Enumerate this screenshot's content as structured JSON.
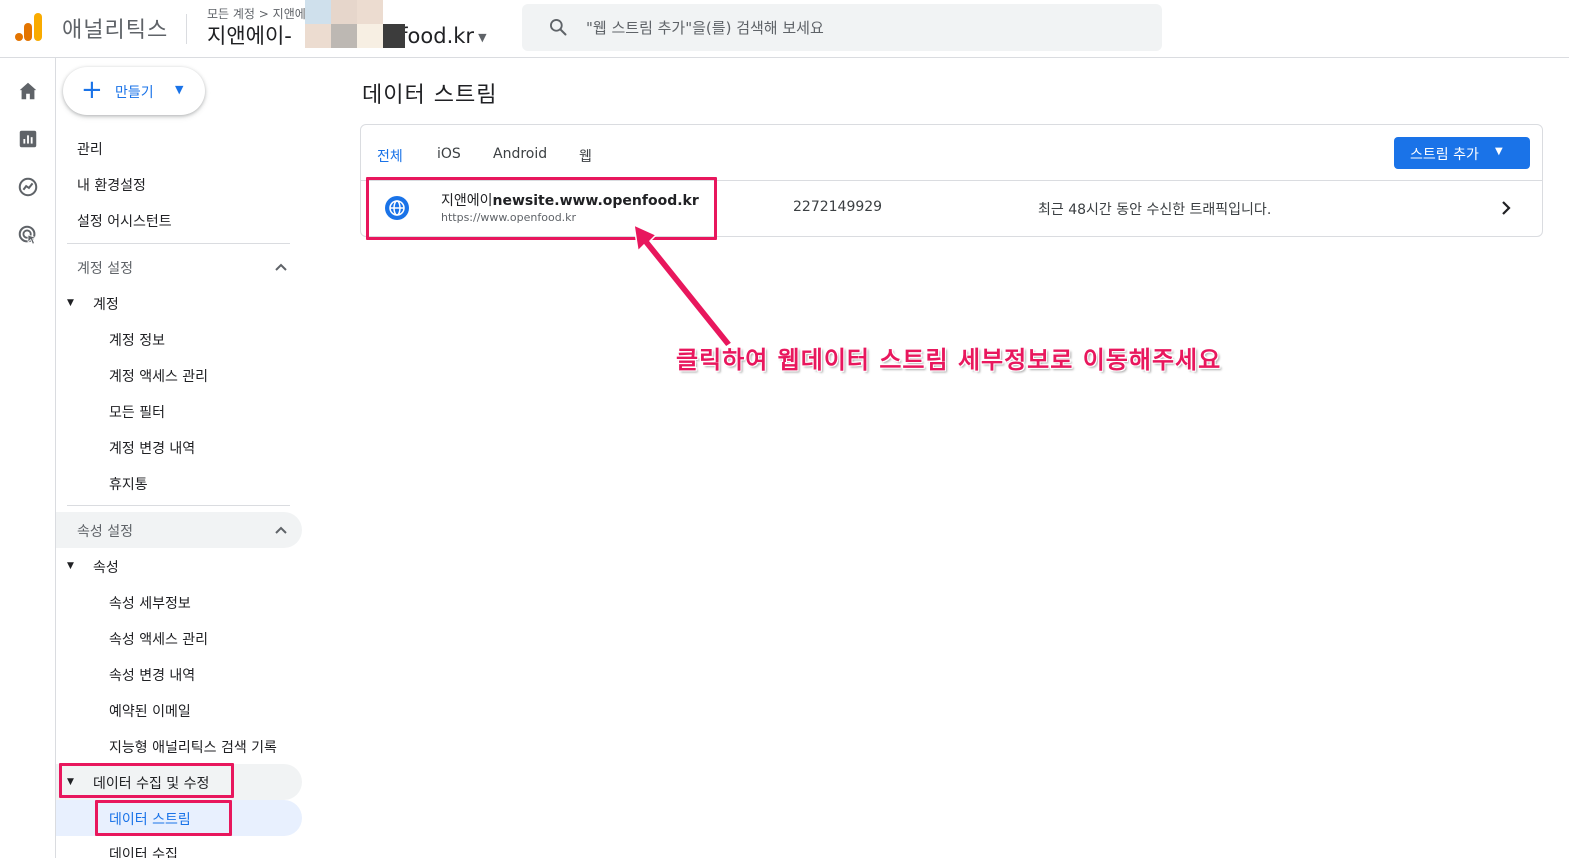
{
  "header": {
    "app_name": "애널리틱스",
    "breadcrumb": "모든 계정 > 지앤에",
    "account_prefix": "지앤에이-",
    "account_suffix": "nfood.kr",
    "search_placeholder": "\"웹 스트림 추가\"을(를) 검색해 보세요"
  },
  "rail": {
    "icons": [
      "home-icon",
      "reports-icon",
      "explore-icon",
      "advertising-icon"
    ]
  },
  "sidebar": {
    "create_label": "만들기",
    "top_items": [
      "관리",
      "내 환경설정",
      "설정 어시스턴트"
    ],
    "account_section": {
      "heading": "계정 설정",
      "group_label": "계정",
      "items": [
        "계정 정보",
        "계정 액세스 관리",
        "모든 필터",
        "계정 변경 내역",
        "휴지통"
      ]
    },
    "property_section": {
      "heading": "속성 설정",
      "group_label": "속성",
      "items": [
        "속성 세부정보",
        "속성 액세스 관리",
        "속성 변경 내역",
        "예약된 이메일",
        "지능형 애널리틱스 검색 기록"
      ]
    },
    "data_section": {
      "group_label": "데이터 수집 및 수정",
      "items": [
        "데이터 스트림",
        "데이터 수집"
      ]
    }
  },
  "main": {
    "title": "데이터 스트림",
    "tabs": [
      "전체",
      "iOS",
      "Android",
      "웹"
    ],
    "active_tab": "전체",
    "add_stream_label": "스트림 추가",
    "stream": {
      "name_prefix": "지앤에이",
      "name_bold": "newsite.www.openfood.kr",
      "url": "https://www.openfood.kr",
      "id": "2272149929",
      "status": "최근 48시간 동안 수신한 트래픽입니다."
    }
  },
  "annotation": {
    "text": "클릭하여 웹데이터 스트림 세부정보로 이동해주세요",
    "color": "#e8175d"
  },
  "colors": {
    "accent": "#1a73e8",
    "highlight": "#e8175d",
    "selected_bg": "#e8f0fe",
    "expanded_bg": "#f1f3f4"
  }
}
